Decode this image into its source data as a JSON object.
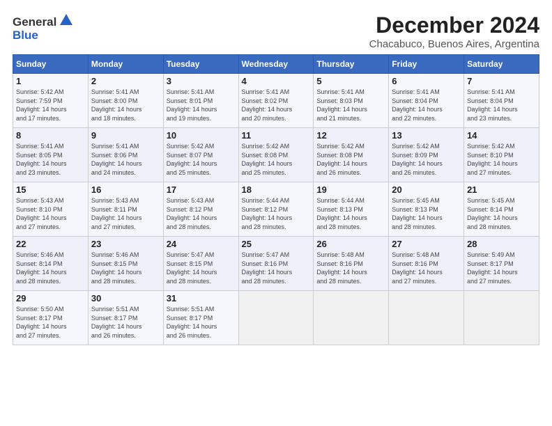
{
  "logo": {
    "general": "General",
    "blue": "Blue"
  },
  "title": "December 2024",
  "subtitle": "Chacabuco, Buenos Aires, Argentina",
  "days_of_week": [
    "Sunday",
    "Monday",
    "Tuesday",
    "Wednesday",
    "Thursday",
    "Friday",
    "Saturday"
  ],
  "weeks": [
    [
      {
        "day": "1",
        "info": "Sunrise: 5:42 AM\nSunset: 7:59 PM\nDaylight: 14 hours\nand 17 minutes."
      },
      {
        "day": "2",
        "info": "Sunrise: 5:41 AM\nSunset: 8:00 PM\nDaylight: 14 hours\nand 18 minutes."
      },
      {
        "day": "3",
        "info": "Sunrise: 5:41 AM\nSunset: 8:01 PM\nDaylight: 14 hours\nand 19 minutes."
      },
      {
        "day": "4",
        "info": "Sunrise: 5:41 AM\nSunset: 8:02 PM\nDaylight: 14 hours\nand 20 minutes."
      },
      {
        "day": "5",
        "info": "Sunrise: 5:41 AM\nSunset: 8:03 PM\nDaylight: 14 hours\nand 21 minutes."
      },
      {
        "day": "6",
        "info": "Sunrise: 5:41 AM\nSunset: 8:04 PM\nDaylight: 14 hours\nand 22 minutes."
      },
      {
        "day": "7",
        "info": "Sunrise: 5:41 AM\nSunset: 8:04 PM\nDaylight: 14 hours\nand 23 minutes."
      }
    ],
    [
      {
        "day": "8",
        "info": "Sunrise: 5:41 AM\nSunset: 8:05 PM\nDaylight: 14 hours\nand 23 minutes."
      },
      {
        "day": "9",
        "info": "Sunrise: 5:41 AM\nSunset: 8:06 PM\nDaylight: 14 hours\nand 24 minutes."
      },
      {
        "day": "10",
        "info": "Sunrise: 5:42 AM\nSunset: 8:07 PM\nDaylight: 14 hours\nand 25 minutes."
      },
      {
        "day": "11",
        "info": "Sunrise: 5:42 AM\nSunset: 8:08 PM\nDaylight: 14 hours\nand 25 minutes."
      },
      {
        "day": "12",
        "info": "Sunrise: 5:42 AM\nSunset: 8:08 PM\nDaylight: 14 hours\nand 26 minutes."
      },
      {
        "day": "13",
        "info": "Sunrise: 5:42 AM\nSunset: 8:09 PM\nDaylight: 14 hours\nand 26 minutes."
      },
      {
        "day": "14",
        "info": "Sunrise: 5:42 AM\nSunset: 8:10 PM\nDaylight: 14 hours\nand 27 minutes."
      }
    ],
    [
      {
        "day": "15",
        "info": "Sunrise: 5:43 AM\nSunset: 8:10 PM\nDaylight: 14 hours\nand 27 minutes."
      },
      {
        "day": "16",
        "info": "Sunrise: 5:43 AM\nSunset: 8:11 PM\nDaylight: 14 hours\nand 27 minutes."
      },
      {
        "day": "17",
        "info": "Sunrise: 5:43 AM\nSunset: 8:12 PM\nDaylight: 14 hours\nand 28 minutes."
      },
      {
        "day": "18",
        "info": "Sunrise: 5:44 AM\nSunset: 8:12 PM\nDaylight: 14 hours\nand 28 minutes."
      },
      {
        "day": "19",
        "info": "Sunrise: 5:44 AM\nSunset: 8:13 PM\nDaylight: 14 hours\nand 28 minutes."
      },
      {
        "day": "20",
        "info": "Sunrise: 5:45 AM\nSunset: 8:13 PM\nDaylight: 14 hours\nand 28 minutes."
      },
      {
        "day": "21",
        "info": "Sunrise: 5:45 AM\nSunset: 8:14 PM\nDaylight: 14 hours\nand 28 minutes."
      }
    ],
    [
      {
        "day": "22",
        "info": "Sunrise: 5:46 AM\nSunset: 8:14 PM\nDaylight: 14 hours\nand 28 minutes."
      },
      {
        "day": "23",
        "info": "Sunrise: 5:46 AM\nSunset: 8:15 PM\nDaylight: 14 hours\nand 28 minutes."
      },
      {
        "day": "24",
        "info": "Sunrise: 5:47 AM\nSunset: 8:15 PM\nDaylight: 14 hours\nand 28 minutes."
      },
      {
        "day": "25",
        "info": "Sunrise: 5:47 AM\nSunset: 8:16 PM\nDaylight: 14 hours\nand 28 minutes."
      },
      {
        "day": "26",
        "info": "Sunrise: 5:48 AM\nSunset: 8:16 PM\nDaylight: 14 hours\nand 28 minutes."
      },
      {
        "day": "27",
        "info": "Sunrise: 5:48 AM\nSunset: 8:16 PM\nDaylight: 14 hours\nand 27 minutes."
      },
      {
        "day": "28",
        "info": "Sunrise: 5:49 AM\nSunset: 8:17 PM\nDaylight: 14 hours\nand 27 minutes."
      }
    ],
    [
      {
        "day": "29",
        "info": "Sunrise: 5:50 AM\nSunset: 8:17 PM\nDaylight: 14 hours\nand 27 minutes."
      },
      {
        "day": "30",
        "info": "Sunrise: 5:51 AM\nSunset: 8:17 PM\nDaylight: 14 hours\nand 26 minutes."
      },
      {
        "day": "31",
        "info": "Sunrise: 5:51 AM\nSunset: 8:17 PM\nDaylight: 14 hours\nand 26 minutes."
      },
      {
        "day": "",
        "info": ""
      },
      {
        "day": "",
        "info": ""
      },
      {
        "day": "",
        "info": ""
      },
      {
        "day": "",
        "info": ""
      }
    ]
  ]
}
